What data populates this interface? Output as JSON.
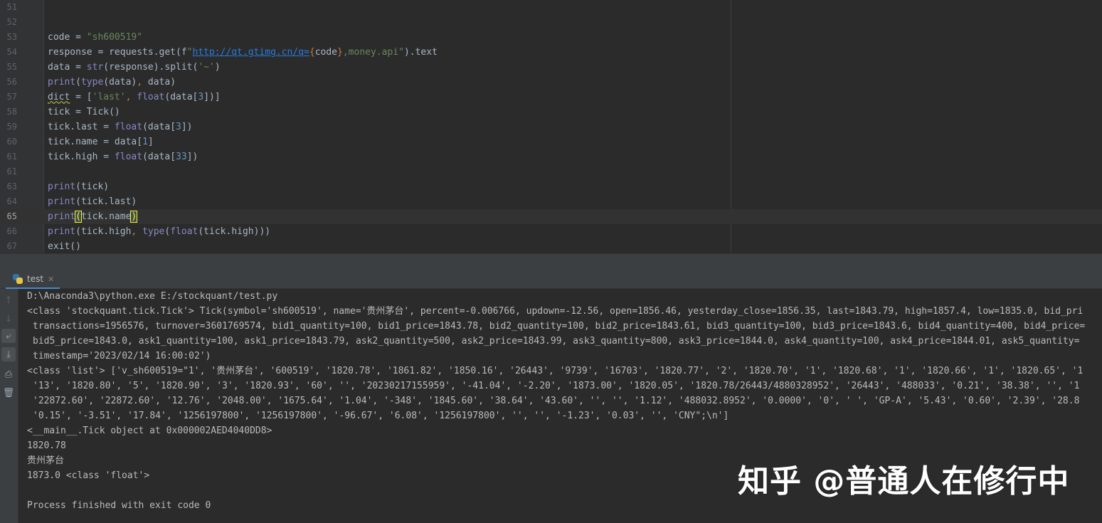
{
  "editor": {
    "lines": [
      {
        "num": "51",
        "tokens": []
      },
      {
        "num": "52",
        "tokens": []
      },
      {
        "num": "53",
        "tokens": [
          [
            "plain",
            "code = "
          ],
          [
            "str",
            "\"sh600519\""
          ]
        ]
      },
      {
        "num": "54",
        "tokens": [
          [
            "plain",
            "response = requests.get(f"
          ],
          [
            "str",
            "\""
          ],
          [
            "link",
            "http://qt.gtimg.cn/q="
          ],
          [
            "punct",
            "{"
          ],
          [
            "plain",
            "code"
          ],
          [
            "punct",
            "}"
          ],
          [
            "str",
            ",money.api\""
          ],
          [
            "plain",
            ").text"
          ]
        ]
      },
      {
        "num": "55",
        "tokens": [
          [
            "plain",
            "data = "
          ],
          [
            "builtin",
            "str"
          ],
          [
            "plain",
            "(response).split("
          ],
          [
            "str",
            "'~'"
          ],
          [
            "plain",
            ")"
          ]
        ]
      },
      {
        "num": "56",
        "tokens": [
          [
            "builtin",
            "print"
          ],
          [
            "plain",
            "("
          ],
          [
            "builtin",
            "type"
          ],
          [
            "plain",
            "(data)"
          ],
          [
            "punct",
            ", "
          ],
          [
            "plain",
            "data)"
          ]
        ]
      },
      {
        "num": "57",
        "tokens": [
          [
            "warn",
            "dict"
          ],
          [
            "plain",
            " = ["
          ],
          [
            "str",
            "'last'"
          ],
          [
            "punct",
            ", "
          ],
          [
            "builtin",
            "float"
          ],
          [
            "plain",
            "(data["
          ],
          [
            "num",
            "3"
          ],
          [
            "plain",
            "])]"
          ]
        ]
      },
      {
        "num": "58",
        "tokens": [
          [
            "plain",
            "tick = Tick()"
          ]
        ]
      },
      {
        "num": "59",
        "tokens": [
          [
            "plain",
            "tick.last = "
          ],
          [
            "builtin",
            "float"
          ],
          [
            "plain",
            "(data["
          ],
          [
            "num",
            "3"
          ],
          [
            "plain",
            "])"
          ]
        ]
      },
      {
        "num": "60",
        "tokens": [
          [
            "plain",
            "tick.name = data["
          ],
          [
            "num",
            "1"
          ],
          [
            "plain",
            "]"
          ]
        ]
      },
      {
        "num": "61",
        "tokens": [
          [
            "plain",
            "tick.high = "
          ],
          [
            "builtin",
            "float"
          ],
          [
            "plain",
            "(data["
          ],
          [
            "num",
            "33"
          ],
          [
            "plain",
            "])"
          ]
        ]
      },
      {
        "num": "61",
        "tokens": []
      },
      {
        "num": "63",
        "tokens": [
          [
            "builtin",
            "print"
          ],
          [
            "plain",
            "(tick)"
          ]
        ]
      },
      {
        "num": "64",
        "tokens": [
          [
            "builtin",
            "print"
          ],
          [
            "plain",
            "(tick.last)"
          ]
        ]
      },
      {
        "num": "65",
        "current": true,
        "tokens": [
          [
            "builtin",
            "print"
          ],
          [
            "brace",
            "("
          ],
          [
            "plain",
            "tick.name"
          ],
          [
            "brace",
            ")"
          ]
        ]
      },
      {
        "num": "66",
        "tokens": [
          [
            "builtin",
            "print"
          ],
          [
            "plain",
            "(tick.high"
          ],
          [
            "punct",
            ", "
          ],
          [
            "builtin",
            "type"
          ],
          [
            "plain",
            "("
          ],
          [
            "builtin",
            "float"
          ],
          [
            "plain",
            "(tick.high)))"
          ]
        ]
      },
      {
        "num": "67",
        "tokens": [
          [
            "plain",
            "exit()"
          ]
        ]
      }
    ]
  },
  "run_panel": {
    "tab_label": "test",
    "close_glyph": "✕",
    "toolbar": [
      {
        "name": "rerun-up-icon",
        "glyph": "↑",
        "dim": true
      },
      {
        "name": "scroll-down-icon",
        "glyph": "↓",
        "dim": true
      },
      {
        "name": "soft-wrap-icon",
        "glyph": "⤶",
        "active": true
      },
      {
        "name": "scroll-to-end-icon",
        "glyph": "⤓",
        "active": true
      },
      {
        "name": "print-icon",
        "glyph": "⎙"
      },
      {
        "name": "trash-icon",
        "glyph": "🗑"
      }
    ],
    "output": [
      {
        "text": "D:\\Anaconda3\\python.exe E:/stockquant/test.py"
      },
      {
        "text": "<class 'stockquant.tick.Tick'> Tick(symbol='sh600519', name='贵州茅台', percent=-0.006766, updown=-12.56, open=1856.46, yesterday_close=1856.35, last=1843.79, high=1857.4, low=1835.0, bid_pri"
      },
      {
        "text": "transactions=1956576, turnover=3601769574, bid1_quantity=100, bid1_price=1843.78, bid2_quantity=100, bid2_price=1843.61, bid3_quantity=100, bid3_price=1843.6, bid4_quantity=400, bid4_price=",
        "cont": true
      },
      {
        "text": "bid5_price=1843.0, ask1_quantity=100, ask1_price=1843.79, ask2_quantity=500, ask2_price=1843.99, ask3_quantity=800, ask3_price=1844.0, ask4_quantity=100, ask4_price=1844.01, ask5_quantity=",
        "cont": true
      },
      {
        "text": "timestamp='2023/02/14 16:00:02')",
        "cont": true
      },
      {
        "text": "<class 'list'> ['v_sh600519=\"1', '贵州茅台', '600519', '1820.78', '1861.82', '1850.16', '26443', '9739', '16703', '1820.77', '2', '1820.70', '1', '1820.68', '1', '1820.66', '1', '1820.65', '1"
      },
      {
        "text": "'13', '1820.80', '5', '1820.90', '3', '1820.93', '60', '', '20230217155959', '-41.04', '-2.20', '1873.00', '1820.05', '1820.78/26443/4880328952', '26443', '488033', '0.21', '38.38', '', '1",
        "cont": true
      },
      {
        "text": "'22872.60', '22872.60', '12.76', '2048.00', '1675.64', '1.04', '-348', '1845.60', '38.64', '43.60', '', '', '1.12', '488032.8952', '0.0000', '0', ' ', 'GP-A', '5.43', '0.60', '2.39', '28.8",
        "cont": true
      },
      {
        "text": "'0.15', '-3.51', '17.84', '1256197800', '1256197800', '-96.67', '6.08', '1256197800', '', '', '-1.23', '0.03', '', 'CNY\";\\n']",
        "cont": true
      },
      {
        "text": "<__main__.Tick object at 0x000002AED4040DD8>"
      },
      {
        "text": "1820.78"
      },
      {
        "text": "贵州茅台"
      },
      {
        "text": "1873.0 <class 'float'>"
      },
      {
        "text": ""
      },
      {
        "text": "Process finished with exit code 0"
      }
    ]
  },
  "watermark": "知乎 @普通人在修行中"
}
